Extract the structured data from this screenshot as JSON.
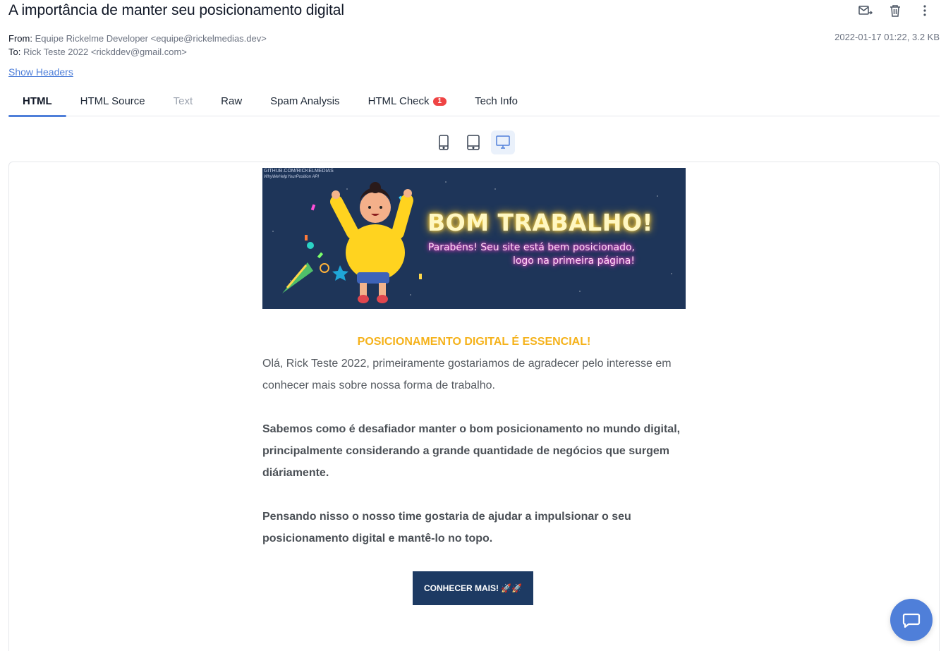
{
  "header": {
    "subject": "A importância de manter seu posicionamento digital",
    "actions": [
      {
        "name": "forward-icon"
      },
      {
        "name": "trash-icon"
      },
      {
        "name": "more-vertical-icon"
      }
    ]
  },
  "meta": {
    "from_label": "From:",
    "from_value": "Equipe Rickelme Developer <equipe@rickelmedias.dev>",
    "to_label": "To:",
    "to_value": "Rick Teste 2022 <rickddev@gmail.com>",
    "date_size": "2022-01-17 01:22, 3.2 KB"
  },
  "show_headers_label": "Show Headers",
  "tabs": [
    {
      "label": "HTML",
      "active": true
    },
    {
      "label": "HTML Source"
    },
    {
      "label": "Text",
      "disabled": true
    },
    {
      "label": "Raw"
    },
    {
      "label": "Spam Analysis"
    },
    {
      "label": "HTML Check",
      "badge": "1"
    },
    {
      "label": "Tech Info"
    }
  ],
  "devices": [
    {
      "name": "mobile-view-icon"
    },
    {
      "name": "tablet-view-icon"
    },
    {
      "name": "desktop-view-icon",
      "active": true
    }
  ],
  "email": {
    "banner": {
      "credit_line1": "GITHUB.COM/RICKELMEDIAS",
      "credit_line2": "WhyWeHelpYourPosition API",
      "title": "BOM TRABALHO!",
      "subtitle_line1": "Parabéns! Seu site está bem posicionado,",
      "subtitle_line2": "logo na primeira página!"
    },
    "heading": "POSICIONAMENTO DIGITAL É ESSENCIAL!",
    "greeting": "Olá, Rick Teste 2022, primeiramente gostariamos de agradecer pelo interesse em conhecer mais sobre nossa forma de trabalho.",
    "paragraph2": "Sabemos como é desafiador manter o bom posicionamento no mundo digital, principalmente considerando a grande quantidade de negócios que surgem diáriamente.",
    "paragraph3": "Pensando nisso o nosso time gostaria de ajudar a impulsionar o seu posicionamento digital e mantê-lo no topo.",
    "cta_label": "CONHECER MAIS! 🚀🚀"
  },
  "colors": {
    "accent": "#4f7fd9",
    "heading_yellow": "#f5b21b",
    "cta_bg": "#1d3a63",
    "badge_red": "#ef4444",
    "banner_bg": "#1e3559"
  }
}
